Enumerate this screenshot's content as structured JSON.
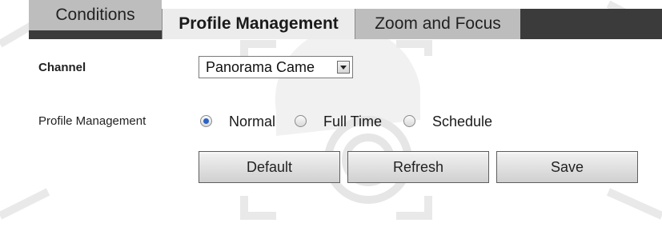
{
  "tabs": [
    {
      "label": "Conditions",
      "active": false
    },
    {
      "label": "Profile Management",
      "active": true
    },
    {
      "label": "Zoom and Focus",
      "active": false
    }
  ],
  "channel": {
    "label": "Channel",
    "selected": "Panorama Came"
  },
  "profile_management": {
    "label": "Profile Management",
    "options": [
      {
        "label": "Normal",
        "checked": true
      },
      {
        "label": "Full Time",
        "checked": false
      },
      {
        "label": "Schedule",
        "checked": false
      }
    ]
  },
  "buttons": {
    "default_label": "Default",
    "refresh_label": "Refresh",
    "save_label": "Save"
  },
  "colors": {
    "tabbar_bg": "#3b3b3b",
    "tab_active_bg": "#ececec",
    "tab_inactive_bg": "#bdbdbd",
    "radio_checked": "#2b63c6"
  }
}
